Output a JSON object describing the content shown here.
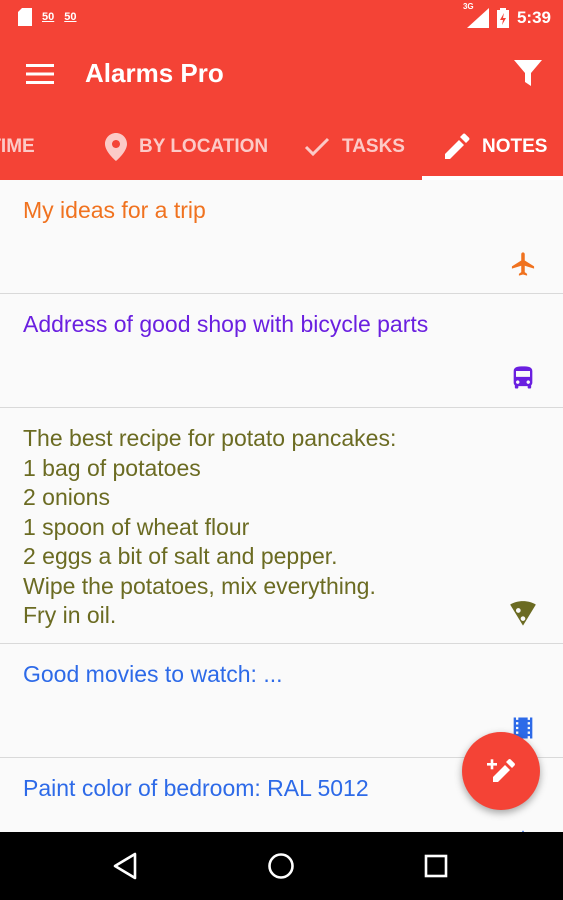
{
  "status_bar": {
    "left_icons": [
      "sd-card-icon",
      "notification-50-icon",
      "notification-50-icon"
    ],
    "notif_label_1": "50",
    "notif_label_2": "50",
    "network_label": "3G",
    "time": "5:39"
  },
  "toolbar": {
    "title": "Alarms Pro",
    "menu_icon": "hamburger-menu-icon",
    "filter_icon": "filter-icon"
  },
  "tabs": [
    {
      "label": "BY TIME",
      "icon": "clock-icon",
      "active": false
    },
    {
      "label": "BY LOCATION",
      "icon": "location-pin-icon",
      "active": false
    },
    {
      "label": "TASKS",
      "icon": "checkmark-icon",
      "active": false
    },
    {
      "label": "NOTES",
      "icon": "pencil-icon",
      "active": true
    }
  ],
  "notes": [
    {
      "text": "My ideas for a trip",
      "color": "#f0721f",
      "icon": "airplane-icon"
    },
    {
      "text": "Address of good shop with bicycle parts",
      "color": "#6a1fe0",
      "icon": "bus-icon"
    },
    {
      "text": "The best recipe for potato pancakes:\n1 bag of potatoes\n2 onions\n1 spoon of wheat flour\n2 eggs a bit of salt and pepper.\nWipe the potatoes, mix everything.\nFry in oil.",
      "color": "#6b6b22",
      "icon": "pizza-slice-icon"
    },
    {
      "text": "Good movies to watch: ...",
      "color": "#2d6ae8",
      "icon": "film-icon"
    },
    {
      "text": "Paint color of bedroom: RAL 5012",
      "color": "#2d6ae8",
      "icon": "paint-icon"
    }
  ],
  "fab": {
    "icon": "new-note-pencil-icon"
  },
  "colors": {
    "primary": "#f44336",
    "background": "#fafafa",
    "navbar": "#000000"
  },
  "nav_bar": {
    "icons": [
      "back-icon",
      "home-icon",
      "recents-icon"
    ]
  }
}
